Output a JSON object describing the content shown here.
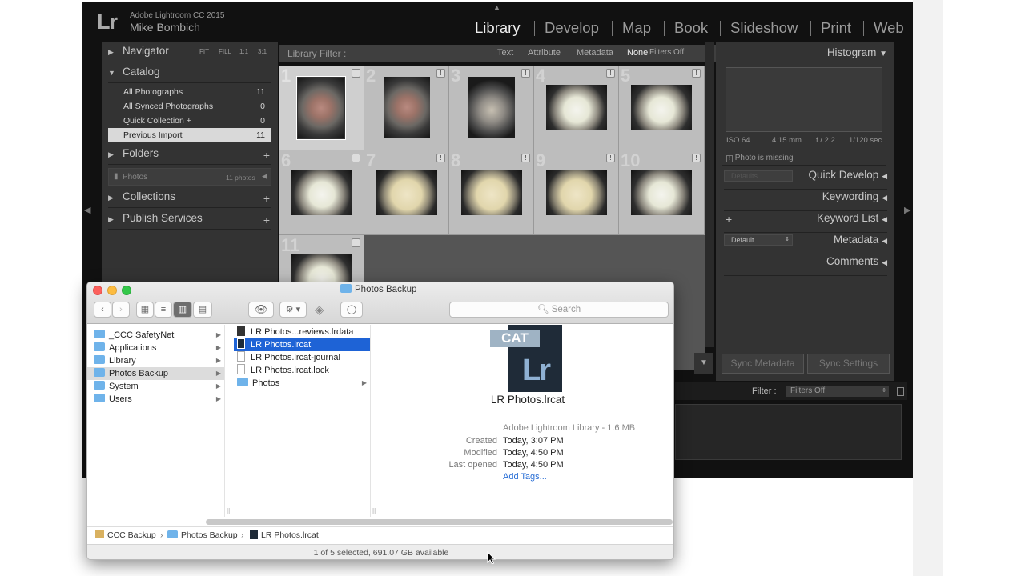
{
  "lightroom": {
    "logo": "Lr",
    "product": "Adobe Lightroom CC 2015",
    "user": "Mike Bombich",
    "modules": [
      "Library",
      "Develop",
      "Map",
      "Book",
      "Slideshow",
      "Print",
      "Web"
    ],
    "active_module": "Library",
    "left_panel": {
      "navigator": {
        "title": "Navigator",
        "zoom": [
          "FIT",
          "FILL",
          "1:1",
          "3:1"
        ]
      },
      "catalog": {
        "title": "Catalog",
        "items": [
          {
            "label": "All Photographs",
            "count": "11"
          },
          {
            "label": "All Synced Photographs",
            "count": "0"
          },
          {
            "label": "Quick Collection +",
            "count": "0"
          },
          {
            "label": "Previous Import",
            "count": "11"
          }
        ]
      },
      "folders": {
        "title": "Folders",
        "folder_name": "Photos",
        "folder_count": "11 photos"
      },
      "collections": {
        "title": "Collections"
      },
      "publish": {
        "title": "Publish Services"
      }
    },
    "filter_bar": {
      "label": "Library Filter :",
      "options": [
        "Text",
        "Attribute",
        "Metadata",
        "None"
      ],
      "status": "Filters Off"
    },
    "grid_numbers": [
      "1",
      "2",
      "3",
      "4",
      "5",
      "6",
      "7",
      "8",
      "9",
      "10",
      "11"
    ],
    "right_panel": {
      "histogram": "Histogram",
      "exif": [
        "ISO 64",
        "4.15 mm",
        "f / 2.2",
        "1/120 sec"
      ],
      "missing": "Photo is missing",
      "preset": "Defaults",
      "quick_develop": "Quick Develop",
      "keywording": "Keywording",
      "keyword_list": "Keyword List",
      "metadata_preset": "Default",
      "metadata": "Metadata",
      "comments": "Comments",
      "sync_metadata": "Sync Metadata",
      "sync_settings": "Sync Settings"
    },
    "filmstrip": {
      "filter_label": "Filter :",
      "filter_value": "Filters Off"
    }
  },
  "finder": {
    "title": "Photos Backup",
    "search_placeholder": "Search",
    "sidebar": [
      {
        "label": "_CCC SafetyNet"
      },
      {
        "label": "Applications"
      },
      {
        "label": "Library"
      },
      {
        "label": "Photos Backup"
      },
      {
        "label": "System"
      },
      {
        "label": "Users"
      }
    ],
    "files": [
      {
        "label": "LR Photos...reviews.lrdata"
      },
      {
        "label": "LR Photos.lrcat"
      },
      {
        "label": "LR Photos.lrcat-journal"
      },
      {
        "label": "LR Photos.lrcat.lock"
      },
      {
        "label": "Photos"
      }
    ],
    "preview": {
      "icon_badge": "CAT",
      "icon_logo": "Lr",
      "filename": "LR Photos.lrcat",
      "kind": "Adobe Lightroom Library - 1.6 MB",
      "created_label": "Created",
      "created": "Today, 3:07 PM",
      "modified_label": "Modified",
      "modified": "Today, 4:50 PM",
      "opened_label": "Last opened",
      "opened": "Today, 4:50 PM",
      "tags": "Add Tags..."
    },
    "path": [
      "CCC Backup",
      "Photos Backup",
      "LR Photos.lrcat"
    ],
    "status": "1 of 5 selected, 691.07 GB available"
  }
}
